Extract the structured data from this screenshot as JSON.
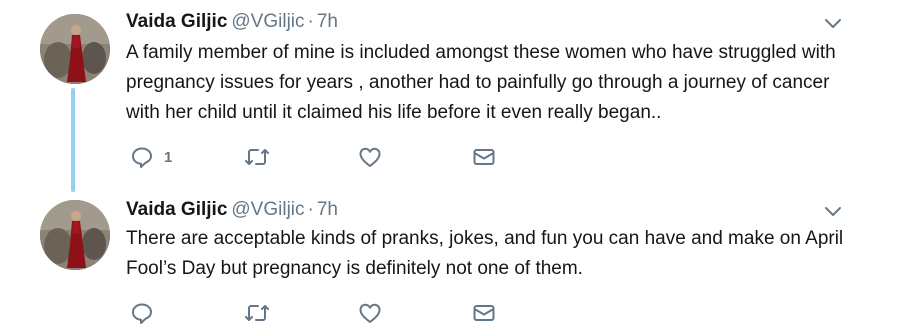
{
  "tweets": [
    {
      "author": {
        "display_name": "Vaida Giljic",
        "handle": "@VGiljic"
      },
      "separator": "·",
      "time": "7h",
      "text": "A family member of mine is included amongst these women who have struggled with pregnancy issues for years , another had to painfully go through a journey of cancer with her child until it claimed his life before it even really began..",
      "reply_count": "1"
    },
    {
      "author": {
        "display_name": "Vaida Giljic",
        "handle": "@VGiljic"
      },
      "separator": "·",
      "time": "7h",
      "text": "There are acceptable kinds of pranks, jokes, and fun you can have and make on April Fool’s Day but pregnancy is definitely not one of them.",
      "reply_count": ""
    }
  ],
  "colors": {
    "thread_line": "#98cff5",
    "icon_gray": "#657786",
    "text": "#14171a"
  },
  "icons": [
    "avatar",
    "chevron-down-icon",
    "reply-icon",
    "retweet-icon",
    "like-icon",
    "direct-message-icon"
  ]
}
